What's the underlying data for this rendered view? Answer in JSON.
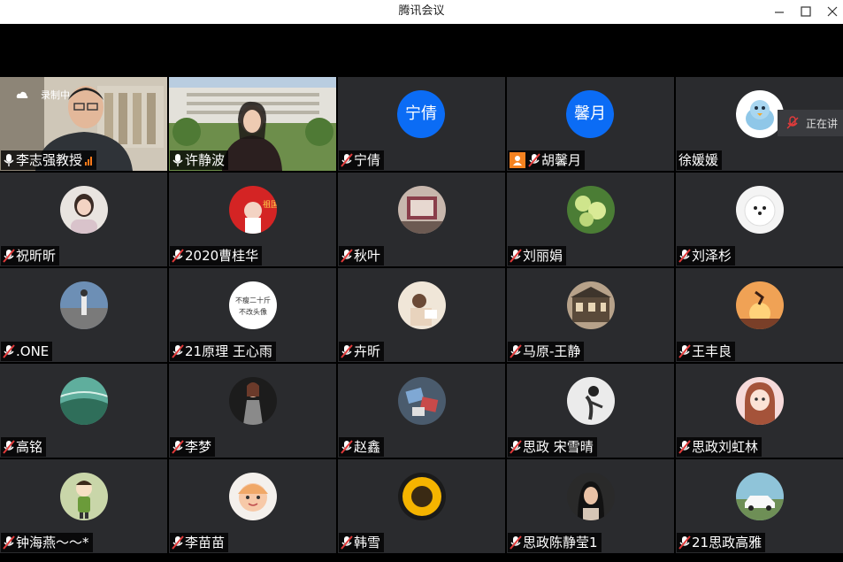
{
  "window": {
    "title": "腾讯会议"
  },
  "recording": {
    "label": "录制中"
  },
  "speaking_tip": {
    "label": "正在讲"
  },
  "participants": [
    {
      "name": "李志强教授",
      "type": "video",
      "mic": "on",
      "active": true
    },
    {
      "name": "许静波",
      "type": "video",
      "mic": "on"
    },
    {
      "name": "宁倩",
      "type": "text",
      "avatar_text": "宁倩",
      "mic": "muted"
    },
    {
      "name": "胡馨月",
      "type": "text",
      "avatar_text": "馨月",
      "mic": "muted",
      "host": true
    },
    {
      "name": "徐媛媛",
      "type": "photo",
      "mic": "none",
      "avatar": "cartoon-bird-avatar"
    },
    {
      "name": "祝昕昕",
      "type": "photo",
      "mic": "muted",
      "avatar": "girl-portrait-avatar"
    },
    {
      "name": "2020曹桂华",
      "type": "photo",
      "mic": "muted",
      "avatar": "red-flag-avatar"
    },
    {
      "name": "秋叶",
      "type": "photo",
      "mic": "muted",
      "avatar": "room-photo-avatar"
    },
    {
      "name": "刘丽娟",
      "type": "photo",
      "mic": "muted",
      "avatar": "fruit-tree-avatar"
    },
    {
      "name": "刘泽杉",
      "type": "photo",
      "mic": "muted",
      "avatar": "white-dog-avatar"
    },
    {
      "name": ".ONE",
      "type": "photo",
      "mic": "muted",
      "avatar": "street-person-avatar"
    },
    {
      "name": "21原理 王心雨",
      "type": "caption",
      "mic": "muted",
      "avatar_caption_1": "不瘦二十斤",
      "avatar_caption_2": "不改头像"
    },
    {
      "name": "卉昕",
      "type": "photo",
      "mic": "muted",
      "avatar": "reading-girl-avatar"
    },
    {
      "name": "马原-王静",
      "type": "photo",
      "mic": "muted",
      "avatar": "old-house-avatar"
    },
    {
      "name": "王丰良",
      "type": "photo",
      "mic": "muted",
      "avatar": "sunset-jump-avatar"
    },
    {
      "name": "高铭",
      "type": "photo",
      "mic": "muted",
      "avatar": "green-landscape-avatar"
    },
    {
      "name": "李梦",
      "type": "photo",
      "mic": "muted",
      "avatar": "woman-coat-avatar"
    },
    {
      "name": "赵鑫",
      "type": "photo",
      "mic": "muted",
      "avatar": "blue-cards-avatar"
    },
    {
      "name": "思政 宋雪晴",
      "type": "photo",
      "mic": "muted",
      "avatar": "dancer-avatar"
    },
    {
      "name": "思政刘虹林",
      "type": "photo",
      "mic": "muted",
      "avatar": "anime-girl-avatar"
    },
    {
      "name": "钟海燕～～*",
      "type": "photo",
      "mic": "muted",
      "avatar": "cartoon-kid-avatar"
    },
    {
      "name": "李苗苗",
      "type": "photo",
      "mic": "muted",
      "avatar": "cartoon-face-avatar"
    },
    {
      "name": "韩雪",
      "type": "photo",
      "mic": "muted",
      "avatar": "sunflower-avatar"
    },
    {
      "name": "思政陈静莹1",
      "type": "photo",
      "mic": "muted",
      "avatar": "dark-hair-girl-avatar"
    },
    {
      "name": "21思政高雅",
      "type": "photo",
      "mic": "muted",
      "avatar": "white-car-avatar"
    }
  ],
  "colors": {
    "accent_blue": "#0b6cf5",
    "active_border": "#28c46a",
    "tile_bg": "#2a2b2e",
    "muted_red": "#e23b3b",
    "signal": "#ff7a1a",
    "host_badge": "#f58220"
  }
}
